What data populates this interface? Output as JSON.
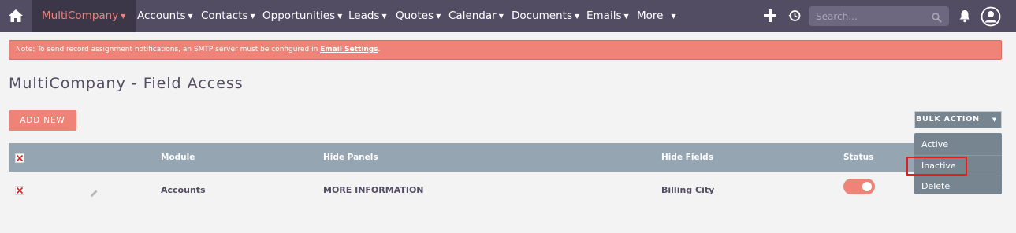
{
  "navbar": {
    "items": [
      {
        "label": "MultiCompany",
        "active": true
      },
      {
        "label": "Accounts"
      },
      {
        "label": "Contacts"
      },
      {
        "label": "Opportunities"
      },
      {
        "label": "Leads"
      },
      {
        "label": "Quotes"
      },
      {
        "label": "Calendar"
      },
      {
        "label": "Documents"
      },
      {
        "label": "Emails"
      },
      {
        "label": "More"
      }
    ],
    "search_placeholder": "Search...",
    "icons": [
      "home-icon",
      "plus-icon",
      "history-icon",
      "search-icon",
      "bell-icon",
      "user-icon"
    ]
  },
  "alert": {
    "text": "Note: To send record assignment notifications, an SMTP server must be configured in ",
    "link": "Email Settings",
    "suffix": "."
  },
  "page": {
    "title": "MultiCompany - Field Access",
    "add_new": "ADD NEW"
  },
  "bulk_action": {
    "label": "BULK ACTION",
    "options": [
      "Active",
      "Inactive",
      "Delete"
    ],
    "highlighted": "Inactive"
  },
  "table": {
    "headers": [
      "Module",
      "Hide Panels",
      "Hide Fields",
      "Status"
    ],
    "rows": [
      {
        "module": "Accounts",
        "hide_panels": "MORE INFORMATION",
        "hide_fields": "Billing City",
        "status_on": true
      }
    ]
  },
  "colors": {
    "navbar": "#534d64",
    "accent": "#f08377",
    "table_header": "#95a5b2",
    "bulk": "#778591"
  }
}
